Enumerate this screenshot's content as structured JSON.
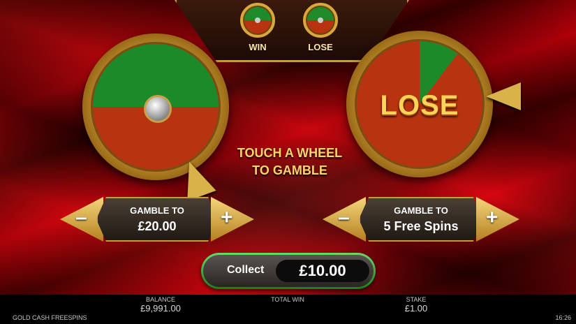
{
  "legend": {
    "win_label": "WIN",
    "lose_label": "LOSE"
  },
  "wheels": {
    "left": {
      "icon": "gamble-wheel-win-half"
    },
    "right": {
      "result_text": "LOSE"
    }
  },
  "instruction": {
    "line1": "TOUCH A WHEEL",
    "line2": "TO GAMBLE"
  },
  "gamble_left": {
    "label": "GAMBLE TO",
    "value": "£20.00",
    "minus": "–",
    "plus": "+"
  },
  "gamble_right": {
    "label": "GAMBLE TO",
    "value": "5 Free Spins",
    "minus": "–",
    "plus": "+"
  },
  "collect": {
    "label": "Collect",
    "amount": "£10.00"
  },
  "status_bar": {
    "game_name": "GOLD CASH FREESPINS",
    "balance_label": "BALANCE",
    "balance_value": "£9,991.00",
    "total_win_label": "TOTAL WIN",
    "total_win_value": "",
    "stake_label": "STAKE",
    "stake_value": "£1.00",
    "clock": "16:26"
  },
  "colors": {
    "win_green": "#1d8a29",
    "lose_red": "#b8330f",
    "gold": "#d9a73c",
    "collect_green": "#2fa52f"
  }
}
